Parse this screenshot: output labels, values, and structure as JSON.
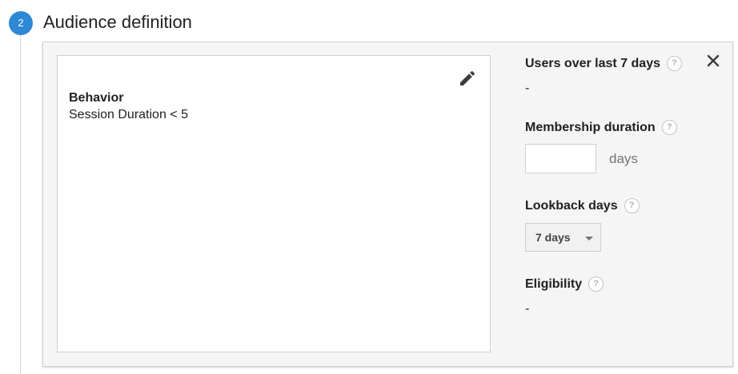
{
  "step": {
    "number": "2",
    "title": "Audience definition"
  },
  "definition": {
    "condition_title": "Behavior",
    "condition_value": "Session Duration < 5"
  },
  "side": {
    "users": {
      "label": "Users over last 7 days",
      "value": "-"
    },
    "membership": {
      "label": "Membership duration",
      "input_value": "",
      "suffix": "days"
    },
    "lookback": {
      "label": "Lookback days",
      "selected": "7 days"
    },
    "eligibility": {
      "label": "Eligibility",
      "value": "-"
    },
    "help_glyph": "?"
  },
  "icons": {
    "edit": "pencil-icon",
    "close": "close-icon",
    "help": "help-icon",
    "dropdown": "chevron-down-icon"
  },
  "colors": {
    "step_circle": "#2d89d6",
    "panel_bg": "#f5f5f5",
    "text": "#212121",
    "muted": "#757575"
  }
}
